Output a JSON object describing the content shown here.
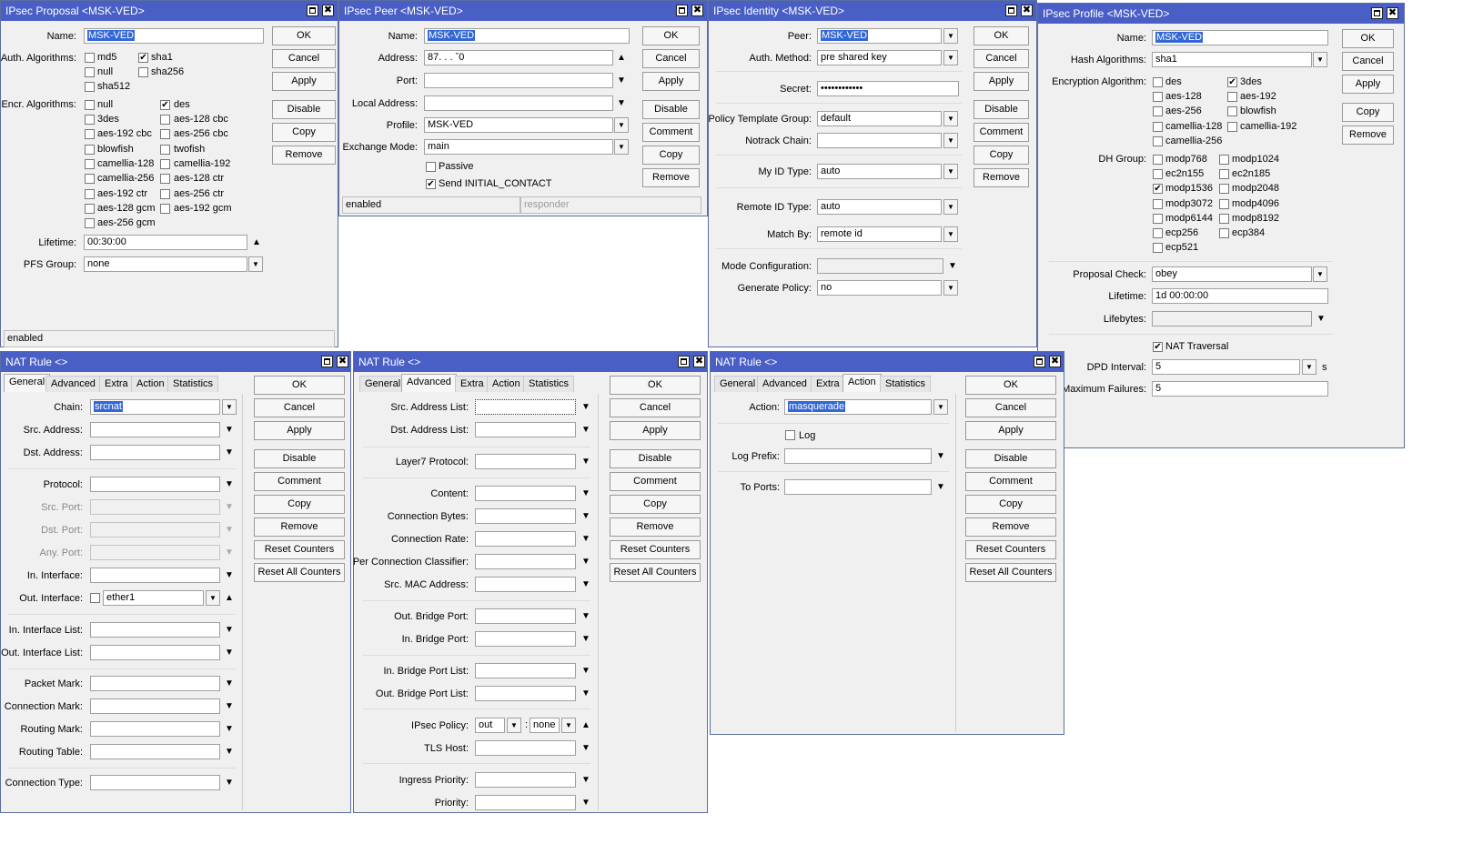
{
  "proposal": {
    "title": "IPsec Proposal <MSK-VED>",
    "name_label": "Name:",
    "name_value": "MSK-VED",
    "auth_label": "Auth. Algorithms:",
    "auth": [
      "md5",
      "sha1",
      "null",
      "sha256",
      "sha512"
    ],
    "encr_label": "Encr. Algorithms:",
    "encr": [
      "null",
      "des",
      "3des",
      "aes-128 cbc",
      "aes-192 cbc",
      "aes-256 cbc",
      "blowfish",
      "twofish",
      "camellia-128",
      "camellia-192",
      "camellia-256",
      "aes-128 ctr",
      "aes-192 ctr",
      "aes-256 ctr",
      "aes-128 gcm",
      "aes-192 gcm",
      "aes-256 gcm"
    ],
    "lifetime_label": "Lifetime:",
    "lifetime_value": "00:30:00",
    "pfs_label": "PFS Group:",
    "pfs_value": "none",
    "buttons": [
      "OK",
      "Cancel",
      "Apply",
      "Disable",
      "Copy",
      "Remove"
    ],
    "status": "enabled"
  },
  "peer": {
    "title": "IPsec Peer <MSK-VED>",
    "name_label": "Name:",
    "name_value": "MSK-VED",
    "address_label": "Address:",
    "address_value": "87.  .    .   ˇ0",
    "port_label": "Port:",
    "port_value": "",
    "local_label": "Local Address:",
    "local_value": "",
    "profile_label": "Profile:",
    "profile_value": "MSK-VED",
    "exchange_label": "Exchange Mode:",
    "exchange_value": "main",
    "passive_label": "Passive",
    "initial_contact_label": "Send INITIAL_CONTACT",
    "buttons": [
      "OK",
      "Cancel",
      "Apply",
      "Disable",
      "Comment",
      "Copy",
      "Remove"
    ],
    "status_left": "enabled",
    "status_right": "responder"
  },
  "identity": {
    "title": "IPsec Identity <MSK-VED>",
    "peer_label": "Peer:",
    "peer_value": "MSK-VED",
    "auth_label": "Auth. Method:",
    "auth_value": "pre shared key",
    "secret_label": "Secret:",
    "secret_value": "••••••••••••",
    "policy_group_label": "Policy Template Group:",
    "policy_group_value": "default",
    "notrack_label": "Notrack Chain:",
    "notrack_value": "",
    "myid_label": "My ID Type:",
    "myid_value": "auto",
    "remoteid_label": "Remote ID Type:",
    "remoteid_value": "auto",
    "matchby_label": "Match By:",
    "matchby_value": "remote id",
    "modecfg_label": "Mode Configuration:",
    "modecfg_value": "",
    "genpolicy_label": "Generate Policy:",
    "genpolicy_value": "no",
    "buttons": [
      "OK",
      "Cancel",
      "Apply",
      "Disable",
      "Comment",
      "Copy",
      "Remove"
    ]
  },
  "profile": {
    "title": "IPsec Profile <MSK-VED>",
    "name_label": "Name:",
    "name_value": "MSK-VED",
    "hash_label": "Hash Algorithms:",
    "hash_value": "sha1",
    "enc_label": "Encryption Algorithm:",
    "enc": [
      "des",
      "3des",
      "aes-128",
      "aes-192",
      "aes-256",
      "blowfish",
      "camellia-128",
      "camellia-192",
      "camellia-256"
    ],
    "dh_label": "DH Group:",
    "dh": [
      "modp768",
      "modp1024",
      "ec2n155",
      "ec2n185",
      "modp1536",
      "modp2048",
      "modp3072",
      "modp4096",
      "modp6144",
      "modp8192",
      "ecp256",
      "ecp384",
      "ecp521"
    ],
    "proposal_check_label": "Proposal Check:",
    "proposal_check_value": "obey",
    "lifetime_label": "Lifetime:",
    "lifetime_value": "1d 00:00:00",
    "lifebytes_label": "Lifebytes:",
    "lifebytes_value": "",
    "nat_traversal_label": "NAT Traversal",
    "dpd_interval_label": "DPD Interval:",
    "dpd_interval_value": "5",
    "dpd_unit": "s",
    "dpd_max_label": ") Maximum Failures:",
    "dpd_max_value": "5",
    "buttons": [
      "OK",
      "Cancel",
      "Apply",
      "Copy",
      "Remove"
    ]
  },
  "nat_tabs": [
    "General",
    "Advanced",
    "Extra",
    "Action",
    "Statistics"
  ],
  "nat_buttons": [
    "OK",
    "Cancel",
    "Apply",
    "Disable",
    "Comment",
    "Copy",
    "Remove",
    "Reset Counters",
    "Reset All Counters"
  ],
  "nat1": {
    "title": "NAT Rule <>",
    "chain_label": "Chain:",
    "chain_value": "srcnat",
    "src_addr_label": "Src. Address:",
    "dst_addr_label": "Dst. Address:",
    "protocol_label": "Protocol:",
    "src_port_label": "Src. Port:",
    "dst_port_label": "Dst. Port:",
    "any_port_label": "Any. Port:",
    "in_iface_label": "In. Interface:",
    "out_iface_label": "Out. Interface:",
    "out_iface_value": "ether1",
    "in_iface_list_label": "In. Interface List:",
    "out_iface_list_label": "Out. Interface List:",
    "packet_mark_label": "Packet Mark:",
    "conn_mark_label": "Connection Mark:",
    "routing_mark_label": "Routing Mark:",
    "routing_table_label": "Routing Table:",
    "conn_type_label": "Connection Type:"
  },
  "nat2": {
    "title": "NAT Rule <>",
    "src_addr_list_label": "Src. Address List:",
    "dst_addr_list_label": "Dst. Address List:",
    "layer7_label": "Layer7 Protocol:",
    "content_label": "Content:",
    "conn_bytes_label": "Connection Bytes:",
    "conn_rate_label": "Connection Rate:",
    "per_conn_label": "Per Connection Classifier:",
    "src_mac_label": "Src. MAC Address:",
    "out_bridge_port_label": "Out. Bridge Port:",
    "in_bridge_port_label": "In. Bridge Port:",
    "in_bridge_list_label": "In. Bridge Port List:",
    "out_bridge_list_label": "Out. Bridge Port List:",
    "ipsec_policy_label": "IPsec Policy:",
    "ipsec_dir_value": "out",
    "ipsec_sep": ":",
    "ipsec_policy_value": "none",
    "tls_host_label": "TLS Host:",
    "ingress_label": "Ingress Priority:",
    "priority_label": "Priority:"
  },
  "nat3": {
    "title": "NAT Rule <>",
    "action_label": "Action:",
    "action_value": "masquerade",
    "log_label": "Log",
    "log_prefix_label": "Log Prefix:",
    "to_ports_label": "To Ports:"
  },
  "glyphs": {
    "check": "✔",
    "down": "▼",
    "up": "▲",
    "close": "✖",
    "combo": "▾"
  }
}
